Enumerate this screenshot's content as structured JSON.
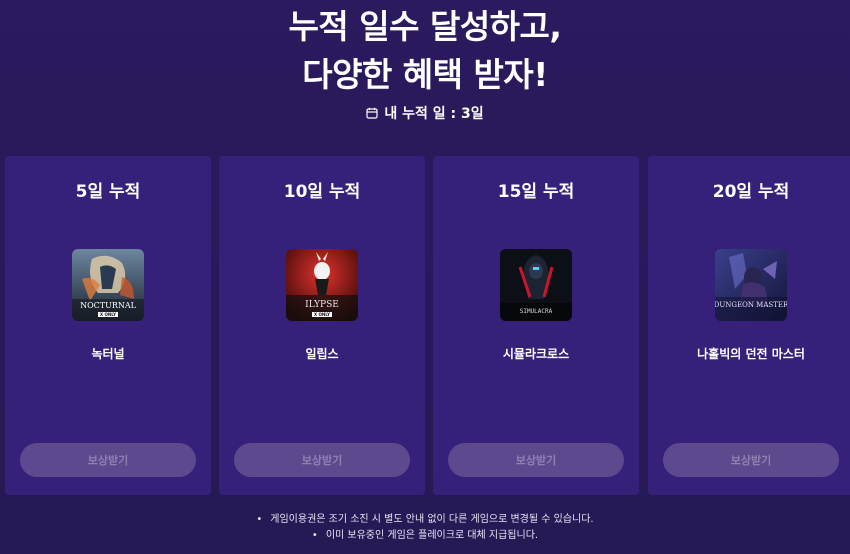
{
  "headline": {
    "line1": "누적 일수 달성하고,",
    "line2": "다양한 혜택 받자!"
  },
  "counter": {
    "label": "내 누적 일 : 3일",
    "icon": "calendar-icon"
  },
  "rewards": [
    {
      "title": "5일 누적",
      "game": "녹터널",
      "art_text": "NOCTURNAL",
      "button": "보상받기"
    },
    {
      "title": "10일 누적",
      "game": "일립스",
      "art_text": "ILYPSE",
      "button": "보상받기"
    },
    {
      "title": "15일 누적",
      "game": "시뮬라크로스",
      "art_text": "SIMULACRA",
      "button": "보상받기"
    },
    {
      "title": "20일 누적",
      "game": "나홀빅의 던전 마스터",
      "art_text": "DUNGEON MASTER",
      "button": "보상받기"
    }
  ],
  "notes": [
    "게임이용권은 조기 소진 시 별도 안내 없이 다른 게임으로 변경될 수 있습니다.",
    "이미 보유중인 게임은 플레이크로 대체 지급됩니다."
  ],
  "colors": {
    "background": "#2b1a5e",
    "card": "#36217a",
    "button_disabled": "#5d4a8e",
    "button_text_disabled": "#8e80b0"
  }
}
